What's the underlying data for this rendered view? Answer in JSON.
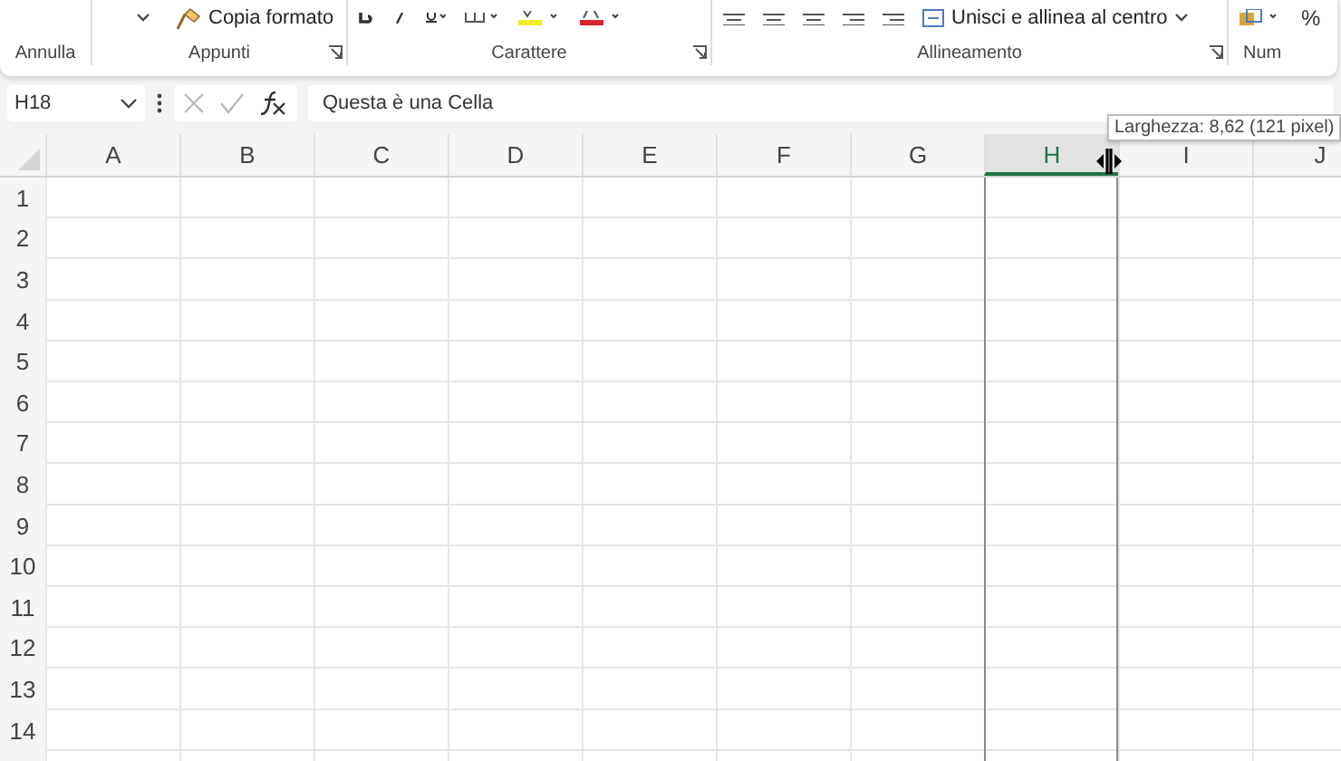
{
  "ribbon": {
    "groups": [
      {
        "label": "Annulla",
        "launcher": false
      },
      {
        "label": "Appunti",
        "launcher": true,
        "commands": [
          {
            "kind": "caret"
          },
          {
            "kind": "brush",
            "label": "Copia formato"
          }
        ]
      },
      {
        "label": "Carattere",
        "launcher": true,
        "commands": [
          {
            "kind": "bold"
          },
          {
            "kind": "italic"
          },
          {
            "kind": "underline"
          },
          {
            "kind": "borders"
          },
          {
            "kind": "highlight"
          },
          {
            "kind": "fontcolor"
          }
        ]
      },
      {
        "label": "Allineamento",
        "launcher": true,
        "commands": [
          {
            "kind": "align"
          },
          {
            "kind": "align"
          },
          {
            "kind": "align"
          },
          {
            "kind": "indent"
          },
          {
            "kind": "indent"
          },
          {
            "kind": "merge",
            "label": "Unisci e allinea al centro"
          }
        ]
      },
      {
        "label": "Num",
        "launcher": false,
        "commands": [
          {
            "kind": "format"
          },
          {
            "kind": "percent",
            "label": "%"
          }
        ]
      }
    ]
  },
  "formula_bar": {
    "name_box": "H18",
    "formula": "Questa è una Cella"
  },
  "columns": [
    {
      "label": "A",
      "selected": false
    },
    {
      "label": "B",
      "selected": false
    },
    {
      "label": "C",
      "selected": false
    },
    {
      "label": "D",
      "selected": false
    },
    {
      "label": "E",
      "selected": false
    },
    {
      "label": "F",
      "selected": false
    },
    {
      "label": "G",
      "selected": false
    },
    {
      "label": "H",
      "selected": true
    },
    {
      "label": "I",
      "selected": false
    },
    {
      "label": "J",
      "selected": false
    }
  ],
  "rows": [
    "1",
    "2",
    "3",
    "4",
    "5",
    "6",
    "7",
    "8",
    "9",
    "10",
    "11",
    "12",
    "13",
    "14"
  ],
  "tooltip": "Larghezza: 8,62 (121 pixel)"
}
